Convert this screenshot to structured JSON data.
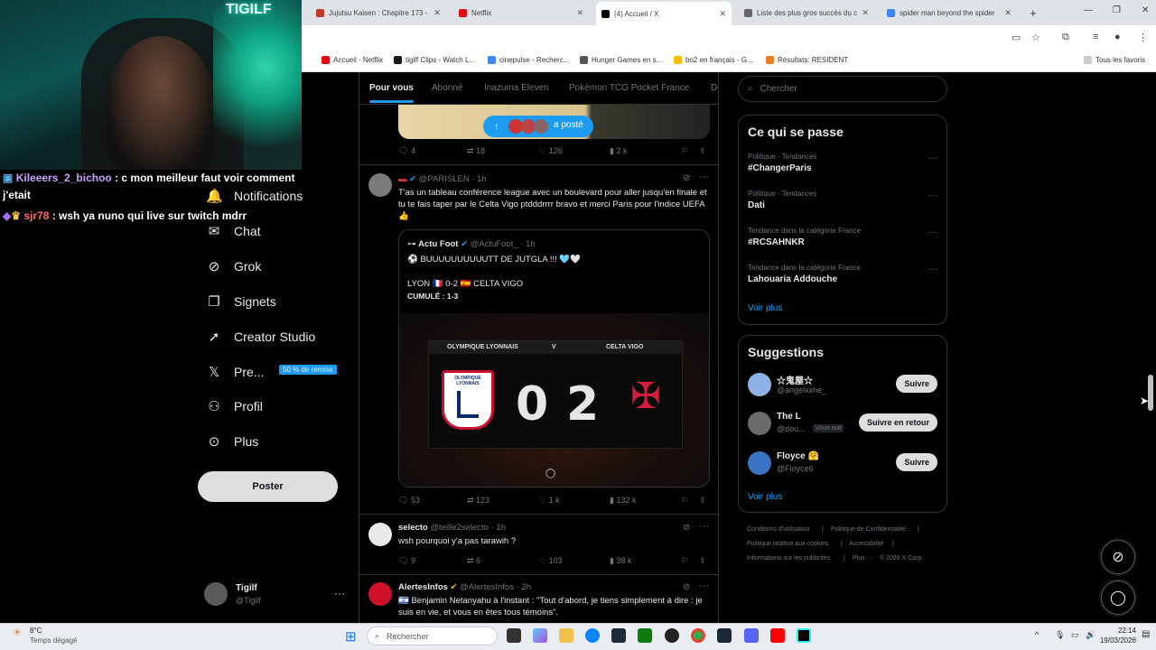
{
  "browser": {
    "tabs": [
      {
        "label": "Jujutsu Kaisen : Chapitre 173 -",
        "color": "#c0392b"
      },
      {
        "label": "Netflix",
        "color": "#e50914"
      },
      {
        "label": "(4) Accueil / X",
        "color": "#000000",
        "active": true
      },
      {
        "label": "Liste des plus gros succès du c",
        "color": "#666666"
      },
      {
        "label": "spider man beyond the spider",
        "color": "#4285f4"
      }
    ],
    "new_tab": "+",
    "bookmarks": [
      "Accueil - Netflix",
      "tigilf Clips - Watch L...",
      "cinepulse - Recherc...",
      "Hunger Games en s...",
      "bo2 en français - G...",
      "Résultats: RESIDENT"
    ],
    "all_bookmarks": "Tous les favoris"
  },
  "webcam": {
    "brand": "TIGILF"
  },
  "chat": [
    {
      "user": "Kileeers_2_bichoo",
      "text": " : c mon meilleur faut voir comment j'etait",
      "color": "#c8a2ff"
    },
    {
      "user": "sjr78",
      "text": " : wsh ya nuno qui live sur twitch mdrr",
      "color": "#ff6b6b"
    }
  ],
  "nav": {
    "items": [
      {
        "label": "Notifications",
        "icon": "🔔"
      },
      {
        "label": "Chat",
        "icon": "✉"
      },
      {
        "label": "Grok",
        "icon": "⊘"
      },
      {
        "label": "Signets",
        "icon": "🔖"
      },
      {
        "label": "Creator Studio",
        "icon": "🚀"
      },
      {
        "label": "Pre...",
        "icon": "𝕏"
      },
      {
        "label": "Profil",
        "icon": "👤"
      },
      {
        "label": "Plus",
        "icon": "⋯"
      }
    ],
    "promo": "50 % de remise",
    "post_button": "Poster",
    "account": {
      "name": "Tigilf",
      "handle": "@Tigilf"
    }
  },
  "feed": {
    "tabs": [
      "Pour vous",
      "Abonné",
      "Inazuma Eleven",
      "Pokémon TCG Pocket France",
      "Dé"
    ],
    "new_posts": "a posté",
    "first_actions": {
      "replies": "4",
      "reposts": "18",
      "likes": "126",
      "views": "2 k"
    },
    "tweet1": {
      "handle": "@PARISLEN",
      "time": "· 1h",
      "text": "T'as un tableau conférence league avec un boulevard pour aller jusqu'en finale et tu te fais taper par le Celta Vigo ptdddrrrr bravo et merci Paris pour l'indice UEFA 👍",
      "quote": {
        "name": "Actu Foot",
        "handle": "@ActuFoot_",
        "time": "· 1h",
        "line1": "⚽ BUUUUUUUUUUTT DE JUTGLA !!! 🩵🤍",
        "line2": "LYON 🇫🇷 0-2 🇪🇸 CELTA VIGO",
        "line3": "CUMULÉ : 1-3",
        "home_team": "OLYMPIQUE LYONNAIS",
        "away_team": "CELTA VIGO",
        "v": "V",
        "score_home": "0",
        "score_away": "2",
        "lyon_logo_text": "OLYMPIQUE LYONNAIS"
      },
      "actions": {
        "replies": "53",
        "reposts": "123",
        "likes": "1 k",
        "views": "132 k"
      }
    },
    "tweet2": {
      "name": "selecto",
      "handle": "@teille2selecto",
      "time": "· 1h",
      "text": "wsh pourquoi y'a pas tarawih ?",
      "actions": {
        "replies": "9",
        "reposts": "6",
        "likes": "103",
        "views": "38 k"
      }
    },
    "tweet3": {
      "name": "AlertesInfos",
      "handle": "@AlertesInfos",
      "time": "· 2h",
      "text": "🇮🇱 Benjamin Netanyahu à l'instant : \"Tout d'abord, je tiens simplement à dire : je suis en vie, et vous en êtes tous témoins\"."
    }
  },
  "right": {
    "search_placeholder": "Chercher",
    "trends_title": "Ce qui se passe",
    "trends": [
      {
        "category": "Politique · Tendances",
        "name": "#ChangerParis"
      },
      {
        "category": "Politique · Tendances",
        "name": "Dati"
      },
      {
        "category": "Tendance dans la catégorie France",
        "name": "#RCSAHNKR"
      },
      {
        "category": "Tendance dans la catégorie France",
        "name": "Lahouaria Addouche"
      }
    ],
    "see_more": "Voir plus",
    "suggestions_title": "Suggestions",
    "suggestions": [
      {
        "name": "☆鬼屋☆",
        "handle": "@angelxxne_",
        "button": "Suivre"
      },
      {
        "name": "The L",
        "handle": "@dou...",
        "badge": "Vous suit",
        "button": "Suivre en retour"
      },
      {
        "name": "Floyce 🤗",
        "handle": "@Floyce6",
        "button": "Suivre"
      }
    ],
    "footer": [
      "Conditions d'utilisation",
      "|",
      "Politique de Confidentialité",
      "|",
      "Politique relative aux cookies",
      "|",
      "Accessibilité",
      "|",
      "Informations sur les publicités",
      "|",
      "Plus ···",
      "© 2026 X Corp."
    ]
  },
  "taskbar": {
    "weather_temp": "8°C",
    "weather_text": "Temps dégagé",
    "search": "Rechercher",
    "time": "22:14",
    "date": "19/03/2026"
  }
}
